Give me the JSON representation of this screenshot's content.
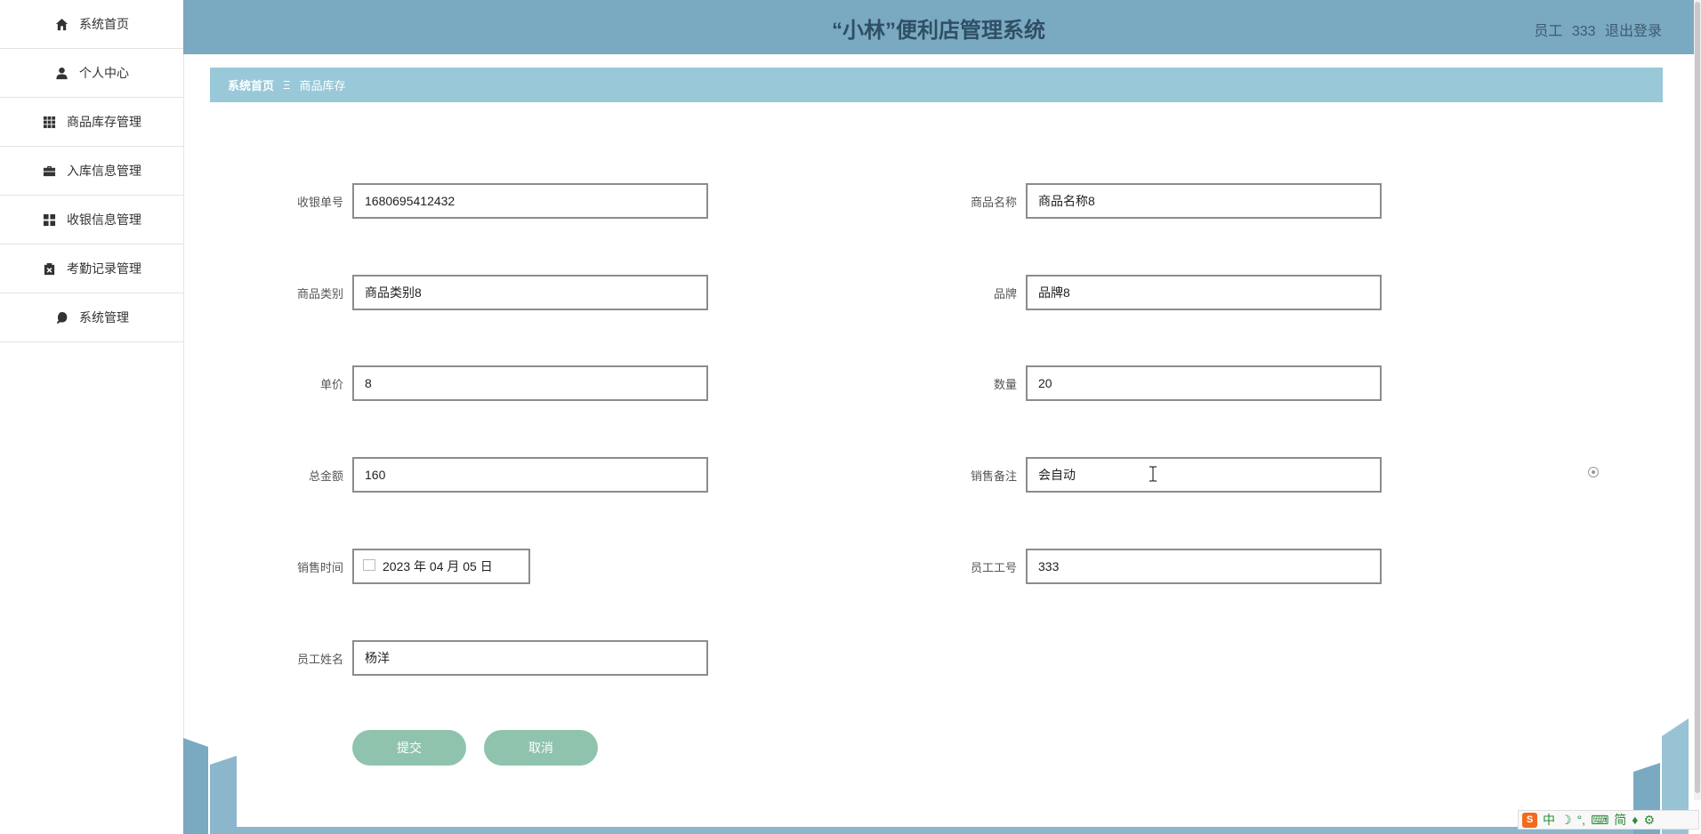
{
  "sidebar": {
    "items": [
      {
        "label": "系统首页",
        "icon": "home-icon"
      },
      {
        "label": "个人中心",
        "icon": "user-icon"
      },
      {
        "label": "商品库存管理",
        "icon": "grid-icon"
      },
      {
        "label": "入库信息管理",
        "icon": "briefcase-icon"
      },
      {
        "label": "收银信息管理",
        "icon": "dashboard-icon"
      },
      {
        "label": "考勤记录管理",
        "icon": "clipboard-icon"
      },
      {
        "label": "系统管理",
        "icon": "leaf-icon"
      }
    ]
  },
  "header": {
    "title": "“小林”便利店管理系统",
    "user_role": "员工",
    "user_id": "333",
    "logout": "退出登录"
  },
  "breadcrumb": {
    "home": "系统首页",
    "separator": "Ξ",
    "current": "商品库存"
  },
  "form": {
    "cashier_no": {
      "label": "收银单号",
      "value": "1680695412432"
    },
    "product_name": {
      "label": "商品名称",
      "value": "商品名称8"
    },
    "category": {
      "label": "商品类别",
      "value": "商品类别8"
    },
    "brand": {
      "label": "品牌",
      "value": "品牌8"
    },
    "unit_price": {
      "label": "单价",
      "value": "8"
    },
    "quantity": {
      "label": "数量",
      "value": "20"
    },
    "total_amount": {
      "label": "总金额",
      "value": "160"
    },
    "sales_note": {
      "label": "销售备注",
      "value": "会自动"
    },
    "sale_time": {
      "label": "销售时间",
      "value": "2023 年 04 月 05 日"
    },
    "employee_id": {
      "label": "员工工号",
      "value": "333"
    },
    "employee_name": {
      "label": "员工姓名",
      "value": "杨洋"
    },
    "submit": "提交",
    "cancel": "取消"
  },
  "ime": {
    "mode": "中",
    "script": "简"
  },
  "colors": {
    "header_bg": "#7aa9c2",
    "breadcrumb_bg": "#99c8d8",
    "button_bg": "#8fc3ad",
    "title_color": "#2f4f64"
  }
}
